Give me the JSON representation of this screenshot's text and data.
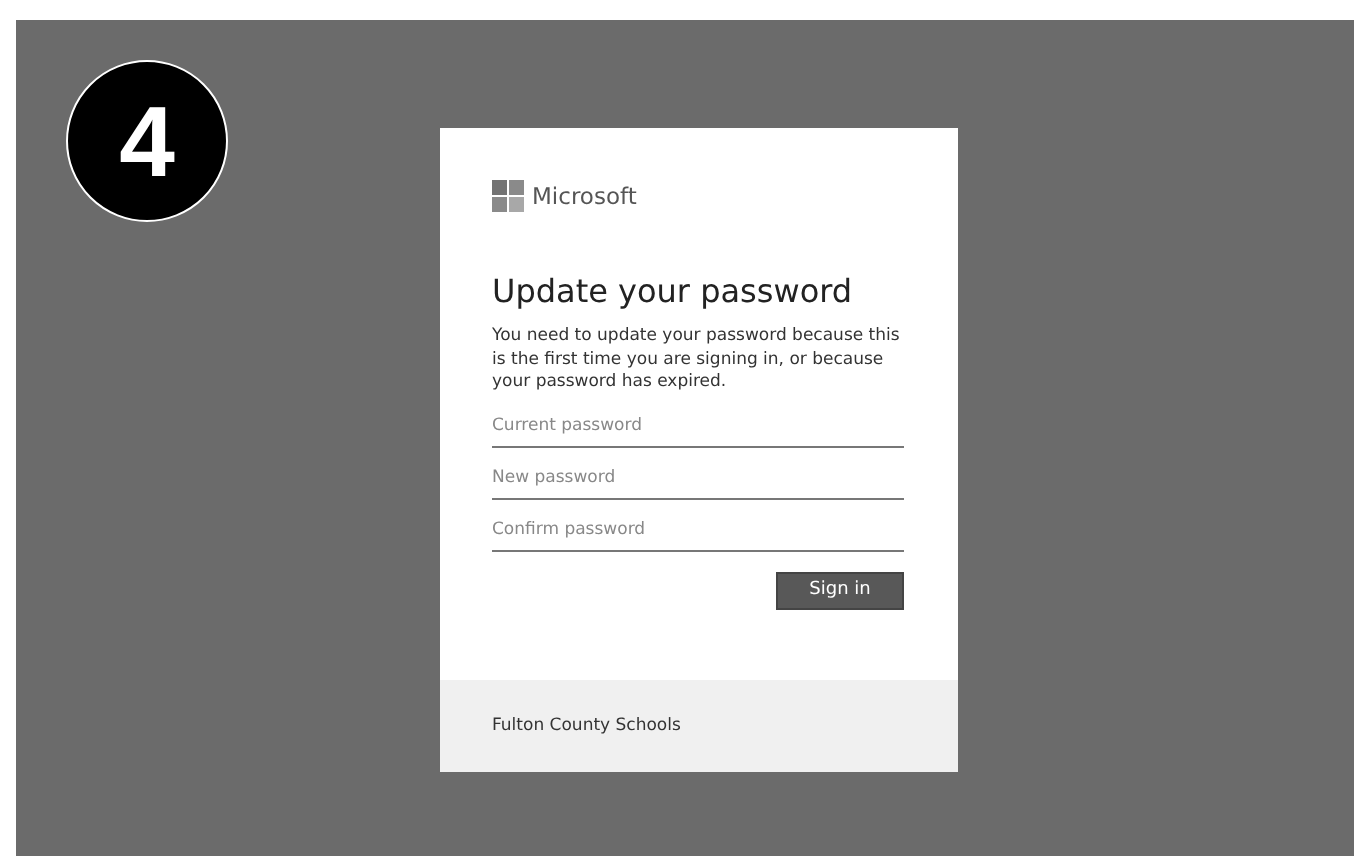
{
  "step_badge": "4",
  "dialog": {
    "brand": "Microsoft",
    "title": "Update your password",
    "message": "You need to update your password because this is the first time you are signing in, or because your password has expired.",
    "fields": [
      {
        "placeholder": "Current password"
      },
      {
        "placeholder": "New password"
      },
      {
        "placeholder": "Confirm password"
      }
    ],
    "button": "Sign in",
    "footer": "Fulton County Schools"
  }
}
